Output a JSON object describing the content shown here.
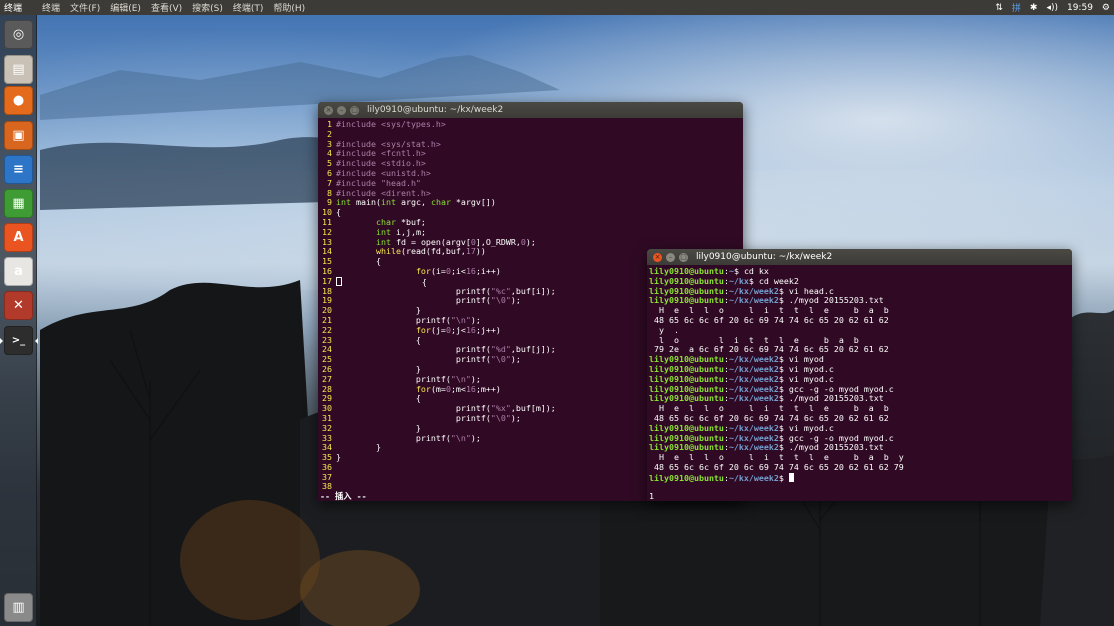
{
  "top_panel": {
    "app_title": "终端",
    "menu": [
      "终端",
      "文件(F)",
      "编辑(E)",
      "查看(V)",
      "搜索(S)",
      "终端(T)",
      "帮助(H)"
    ],
    "indicators": {
      "network": "⇅",
      "input_method": "拼",
      "bluetooth": "✱",
      "volume": "◂))",
      "clock": "19:59",
      "settings": "⚙"
    }
  },
  "launcher": {
    "items": [
      {
        "name": "dash-home",
        "icon": "ubuntu-logo-icon",
        "color": "#5a5a5a"
      },
      {
        "name": "files",
        "icon": "files-cabinet-icon",
        "color": "#c9c1b5"
      },
      {
        "name": "firefox",
        "icon": "firefox-icon",
        "color": "#e46a1c"
      },
      {
        "name": "libreoffice-impress",
        "icon": "impress-icon",
        "color": "#d9661f"
      },
      {
        "name": "libreoffice-writer",
        "icon": "writer-icon",
        "color": "#2c75c7"
      },
      {
        "name": "libreoffice-calc",
        "icon": "calc-icon",
        "color": "#3f9c35"
      },
      {
        "name": "software-center",
        "icon": "software-center-icon",
        "color": "#e95420"
      },
      {
        "name": "amazon",
        "icon": "amazon-icon",
        "color": "#e8e6e3"
      },
      {
        "name": "system-settings",
        "icon": "settings-wrench-icon",
        "color": "#b23a2a"
      },
      {
        "name": "terminal",
        "icon": "terminal-icon",
        "color": "#2d2d2d"
      },
      {
        "name": "trash",
        "icon": "trash-icon",
        "color": "#8a8a8a"
      }
    ],
    "glyphs": [
      "◎",
      "▤",
      "●",
      "▣",
      "≡",
      "▦",
      "A",
      "a",
      "✕",
      ">_",
      "▥"
    ]
  },
  "vim_window": {
    "title": "lily0910@ubuntu: ~/kx/week2",
    "lines": [
      [
        {
          "t": "#include ",
          "c": "pre"
        },
        {
          "t": "<sys/types.h>",
          "c": "str"
        }
      ],
      [],
      [
        {
          "t": "#include ",
          "c": "pre"
        },
        {
          "t": "<sys/stat.h>",
          "c": "str"
        }
      ],
      [
        {
          "t": "#include ",
          "c": "pre"
        },
        {
          "t": "<fcntl.h>",
          "c": "str"
        }
      ],
      [
        {
          "t": "#include ",
          "c": "pre"
        },
        {
          "t": "<stdio.h>",
          "c": "str"
        }
      ],
      [
        {
          "t": "#include ",
          "c": "pre"
        },
        {
          "t": "<unistd.h>",
          "c": "str"
        }
      ],
      [
        {
          "t": "#include ",
          "c": "pre"
        },
        {
          "t": "\"head.h\"",
          "c": "str"
        }
      ],
      [
        {
          "t": "#include ",
          "c": "pre"
        },
        {
          "t": "<dirent.h>",
          "c": "str"
        }
      ],
      [
        {
          "t": "int",
          "c": "type"
        },
        {
          "t": " main(",
          "c": ""
        },
        {
          "t": "int",
          "c": "type"
        },
        {
          "t": " argc, ",
          "c": ""
        },
        {
          "t": "char",
          "c": "type"
        },
        {
          "t": " *argv[])",
          "c": ""
        }
      ],
      [
        {
          "t": "{",
          "c": ""
        }
      ],
      [
        {
          "t": "        ",
          "c": ""
        },
        {
          "t": "char",
          "c": "type"
        },
        {
          "t": " *buf;",
          "c": ""
        }
      ],
      [
        {
          "t": "        ",
          "c": ""
        },
        {
          "t": "int",
          "c": "type"
        },
        {
          "t": " i,j,m;",
          "c": ""
        }
      ],
      [
        {
          "t": "        ",
          "c": ""
        },
        {
          "t": "int",
          "c": "type"
        },
        {
          "t": " fd = open(argv[",
          "c": ""
        },
        {
          "t": "0",
          "c": "num"
        },
        {
          "t": "],O_RDWR,",
          "c": ""
        },
        {
          "t": "0",
          "c": "num"
        },
        {
          "t": ");",
          "c": ""
        }
      ],
      [
        {
          "t": "        ",
          "c": ""
        },
        {
          "t": "while",
          "c": "kw"
        },
        {
          "t": "(read(fd,buf,",
          "c": ""
        },
        {
          "t": "17",
          "c": "num"
        },
        {
          "t": "))",
          "c": ""
        }
      ],
      [
        {
          "t": "        {",
          "c": ""
        }
      ],
      [
        {
          "t": "                ",
          "c": ""
        },
        {
          "t": "for",
          "c": "kw"
        },
        {
          "t": "(i=",
          "c": ""
        },
        {
          "t": "0",
          "c": "num"
        },
        {
          "t": ";i<",
          "c": ""
        },
        {
          "t": "16",
          "c": "num"
        },
        {
          "t": ";i++)",
          "c": ""
        }
      ],
      [
        {
          "t": "                {",
          "c": ""
        }
      ],
      [
        {
          "t": "                        printf(",
          "c": ""
        },
        {
          "t": "\"%c\"",
          "c": "str"
        },
        {
          "t": ",buf[i]);",
          "c": ""
        }
      ],
      [
        {
          "t": "                        printf(",
          "c": ""
        },
        {
          "t": "\"\\0\"",
          "c": "str"
        },
        {
          "t": ");",
          "c": ""
        }
      ],
      [
        {
          "t": "                }",
          "c": ""
        }
      ],
      [
        {
          "t": "                printf(",
          "c": ""
        },
        {
          "t": "\"\\n\"",
          "c": "str"
        },
        {
          "t": ");",
          "c": ""
        }
      ],
      [
        {
          "t": "                ",
          "c": ""
        },
        {
          "t": "for",
          "c": "kw"
        },
        {
          "t": "(j=",
          "c": ""
        },
        {
          "t": "0",
          "c": "num"
        },
        {
          "t": ";j<",
          "c": ""
        },
        {
          "t": "16",
          "c": "num"
        },
        {
          "t": ";j++)",
          "c": ""
        }
      ],
      [
        {
          "t": "                {",
          "c": ""
        }
      ],
      [
        {
          "t": "                        printf(",
          "c": ""
        },
        {
          "t": "\"%d\"",
          "c": "str"
        },
        {
          "t": ",buf[j]);",
          "c": ""
        }
      ],
      [
        {
          "t": "                        printf(",
          "c": ""
        },
        {
          "t": "\"\\0\"",
          "c": "str"
        },
        {
          "t": ");",
          "c": ""
        }
      ],
      [
        {
          "t": "                }",
          "c": ""
        }
      ],
      [
        {
          "t": "                printf(",
          "c": ""
        },
        {
          "t": "\"\\n\"",
          "c": "str"
        },
        {
          "t": ");",
          "c": ""
        }
      ],
      [
        {
          "t": "                ",
          "c": ""
        },
        {
          "t": "for",
          "c": "kw"
        },
        {
          "t": "(m=",
          "c": ""
        },
        {
          "t": "0",
          "c": "num"
        },
        {
          "t": ";m<",
          "c": ""
        },
        {
          "t": "16",
          "c": "num"
        },
        {
          "t": ";m++)",
          "c": ""
        }
      ],
      [
        {
          "t": "                {",
          "c": ""
        }
      ],
      [
        {
          "t": "                        printf(",
          "c": ""
        },
        {
          "t": "\"%x\"",
          "c": "str"
        },
        {
          "t": ",buf[m]);",
          "c": ""
        }
      ],
      [
        {
          "t": "                        printf(",
          "c": ""
        },
        {
          "t": "\"\\0\"",
          "c": "str"
        },
        {
          "t": ");",
          "c": ""
        }
      ],
      [
        {
          "t": "                }",
          "c": ""
        }
      ],
      [
        {
          "t": "                printf(",
          "c": ""
        },
        {
          "t": "\"\\n\"",
          "c": "str"
        },
        {
          "t": ");",
          "c": ""
        }
      ],
      [
        {
          "t": "        }",
          "c": ""
        }
      ],
      [
        {
          "t": "}",
          "c": ""
        }
      ],
      [],
      [],
      []
    ],
    "cursor_line": 17,
    "mode_line": "-- 插入 --"
  },
  "shell_window": {
    "title": "lily0910@ubuntu: ~/kx/week2",
    "lines": [
      {
        "user": "lily0910@ubuntu",
        "path": "~",
        "cmd": "cd kx"
      },
      {
        "user": "lily0910@ubuntu",
        "path": "~/kx",
        "cmd": "cd week2"
      },
      {
        "user": "lily0910@ubuntu",
        "path": "~/kx/week2",
        "cmd": "vi head.c"
      },
      {
        "user": "lily0910@ubuntu",
        "path": "~/kx/week2",
        "cmd": "./myod 20155203.txt"
      },
      {
        "out": "  H  e  l  l  o     l  i  t  t  l  e     b  a  b"
      },
      {
        "out": " 48 65 6c 6c 6f 20 6c 69 74 74 6c 65 20 62 61 62"
      },
      {
        "out": "  y  ."
      },
      {
        "out": "  l  o        l  i  t  t  l  e     b  a  b"
      },
      {
        "out": " 79 2e  a 6c 6f 20 6c 69 74 74 6c 65 20 62 61 62"
      },
      {
        "user": "lily0910@ubuntu",
        "path": "~/kx/week2",
        "cmd": "vi myod"
      },
      {
        "user": "lily0910@ubuntu",
        "path": "~/kx/week2",
        "cmd": "vi myod.c"
      },
      {
        "user": "lily0910@ubuntu",
        "path": "~/kx/week2",
        "cmd": "vi myod.c"
      },
      {
        "user": "lily0910@ubuntu",
        "path": "~/kx/week2",
        "cmd": "gcc -g -o myod myod.c"
      },
      {
        "user": "lily0910@ubuntu",
        "path": "~/kx/week2",
        "cmd": "./myod 20155203.txt"
      },
      {
        "out": "  H  e  l  l  o     l  i  t  t  l  e     b  a  b"
      },
      {
        "out": " 48 65 6c 6c 6f 20 6c 69 74 74 6c 65 20 62 61 62"
      },
      {
        "user": "lily0910@ubuntu",
        "path": "~/kx/week2",
        "cmd": "vi myod.c"
      },
      {
        "user": "lily0910@ubuntu",
        "path": "~/kx/week2",
        "cmd": "gcc -g -o myod myod.c"
      },
      {
        "user": "lily0910@ubuntu",
        "path": "~/kx/week2",
        "cmd": "./myod 20155203.txt"
      },
      {
        "out": "  H  e  l  l  o     l  i  t  t  l  e     b  a  b  y"
      },
      {
        "out": " 48 65 6c 6c 6f 20 6c 69 74 74 6c 65 20 62 61 62 79"
      },
      {
        "user": "lily0910@ubuntu",
        "path": "~/kx/week2",
        "cmd": "",
        "cursor": true
      },
      {
        "out": ""
      },
      {
        "out": "1"
      }
    ]
  },
  "colors": {
    "terminal_bg": "#300a24",
    "prompt_user": "#8ae234",
    "prompt_path": "#729fcf",
    "line_number": "#fce94f",
    "close_button": "#e95420",
    "panel_bg": "#3c3b37"
  }
}
